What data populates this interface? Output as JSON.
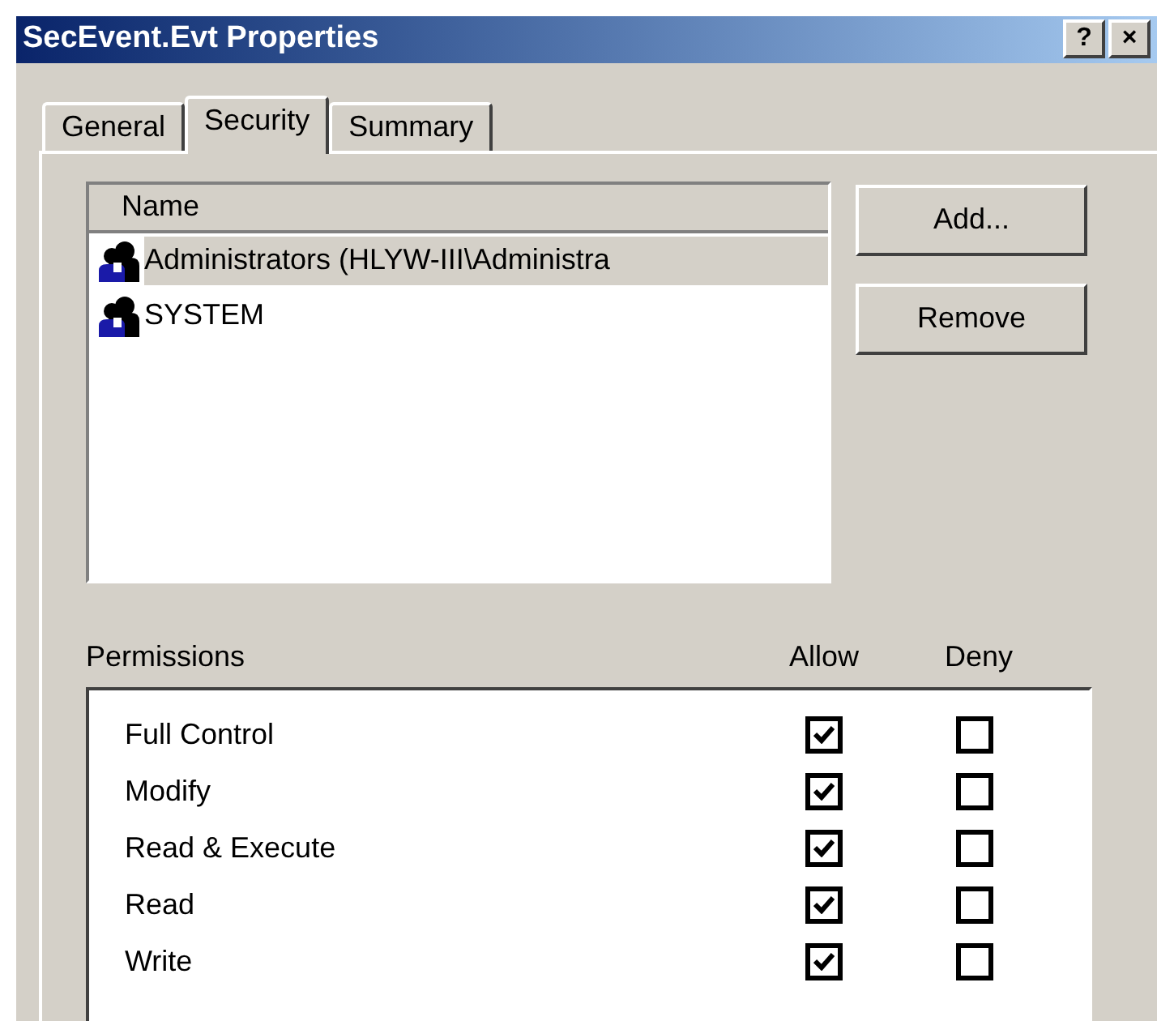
{
  "window": {
    "title": "SecEvent.Evt Properties",
    "title_buttons": [
      "?",
      "×"
    ]
  },
  "tabs": [
    {
      "label": "General",
      "selected": false
    },
    {
      "label": "Security",
      "selected": true
    },
    {
      "label": "Summary",
      "selected": false
    }
  ],
  "names": {
    "column": "Name",
    "items": [
      {
        "label": "Administrators (HLYW-III\\Administra",
        "selected": true
      },
      {
        "label": "SYSTEM",
        "selected": false
      }
    ]
  },
  "buttons": [
    "Add...",
    "Remove"
  ],
  "permissions": {
    "label": "Permissions",
    "allow": "Allow",
    "deny": "Deny",
    "rows": [
      {
        "label": "Full Control",
        "allow": true,
        "deny": false
      },
      {
        "label": "Modify",
        "allow": true,
        "deny": false
      },
      {
        "label": "Read & Execute",
        "allow": true,
        "deny": false
      },
      {
        "label": "Read",
        "allow": true,
        "deny": false
      },
      {
        "label": "Write",
        "allow": true,
        "deny": false
      }
    ]
  }
}
